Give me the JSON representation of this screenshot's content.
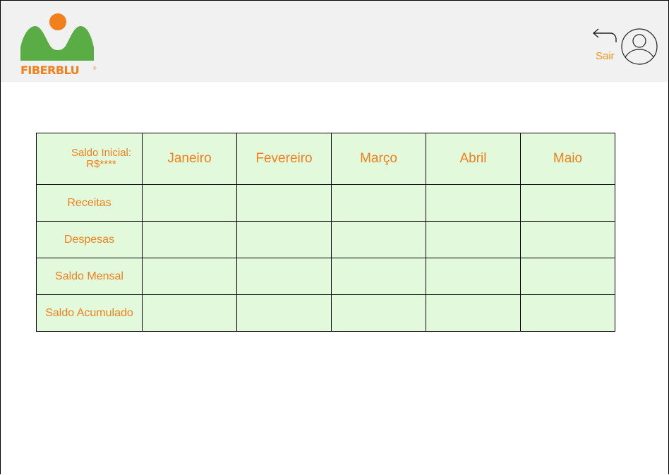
{
  "header": {
    "logo_text": "FIBERBLU",
    "logo_reg": "®",
    "logout_label": "Sair"
  },
  "table": {
    "corner_line1": "Saldo Inicial:",
    "corner_line2": "R$****",
    "months": [
      "Janeiro",
      "Fevereiro",
      "Março",
      "Abril",
      "Maio"
    ],
    "rows": [
      "Receitas",
      "Despesas",
      "Saldo Mensal",
      "Saldo Acumulado"
    ]
  },
  "colors": {
    "orange": "#f07f1c",
    "green_logo": "#5aac44",
    "cell_bg": "#e2f9dc",
    "header_bg": "#f1f1f1"
  },
  "icons": [
    "back-arrow-icon",
    "user-avatar-icon"
  ]
}
